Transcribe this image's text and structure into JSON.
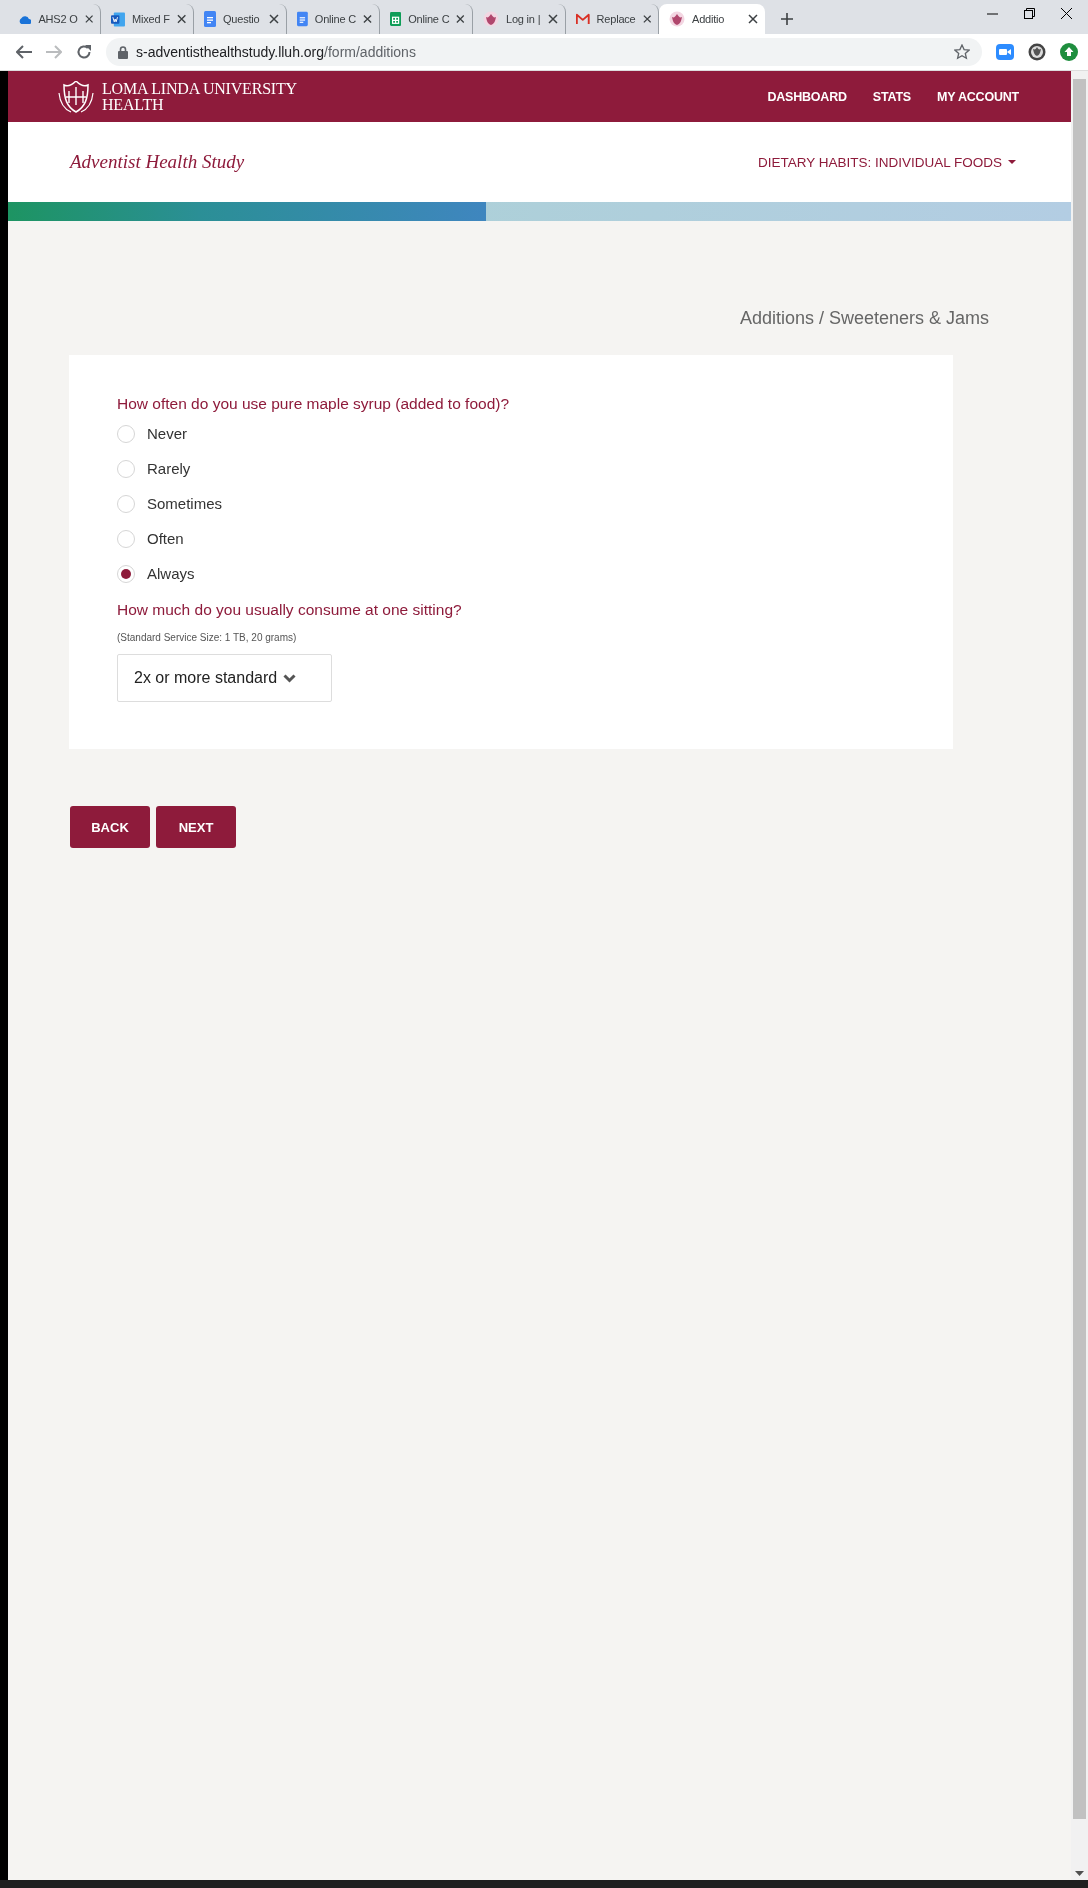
{
  "browser": {
    "tabs": [
      {
        "title": "AHS2 O",
        "kind": "cloud",
        "selected": false
      },
      {
        "title": "Mixed F",
        "kind": "word",
        "selected": false
      },
      {
        "title": "Questio",
        "kind": "doc",
        "selected": false
      },
      {
        "title": "Online C",
        "kind": "doc",
        "selected": false
      },
      {
        "title": "Online C",
        "kind": "sheet",
        "selected": false
      },
      {
        "title": "Log in |",
        "kind": "crest",
        "selected": false
      },
      {
        "title": "Replace",
        "kind": "mail",
        "selected": false
      },
      {
        "title": "Additio",
        "kind": "crest",
        "selected": true
      }
    ],
    "url": {
      "host": "s-adventisthealthstudy.lluh.org",
      "path": "/form/additions"
    }
  },
  "header": {
    "logo_lines": [
      "LOMA LINDA UNIVERSITY",
      "HEALTH"
    ],
    "nav": [
      "DASHBOARD",
      "STATS",
      "MY ACCOUNT"
    ]
  },
  "study_title": "Adventist Health Study",
  "section_menu": "DIETARY HABITS: INDIVIDUAL FOODS",
  "progress": {
    "level": 0.45
  },
  "breadcrumb": "Additions / Sweeteners & Jams",
  "questions": [
    {
      "kind": "radio",
      "prompt": "How often do you use pure maple syrup (added to food)?",
      "options": [
        {
          "label": "Never",
          "selected": false
        },
        {
          "label": "Rarely",
          "selected": false
        },
        {
          "label": "Sometimes",
          "selected": false
        },
        {
          "label": "Often",
          "selected": false
        },
        {
          "label": "Always",
          "selected": true
        }
      ]
    },
    {
      "kind": "select",
      "prompt": "How much do you usually consume at one sitting?",
      "note": "(Standard Service Size: 1 TB, 20 grams)",
      "value": "2x or more standard"
    }
  ],
  "buttons": [
    "BACK",
    "NEXT"
  ]
}
